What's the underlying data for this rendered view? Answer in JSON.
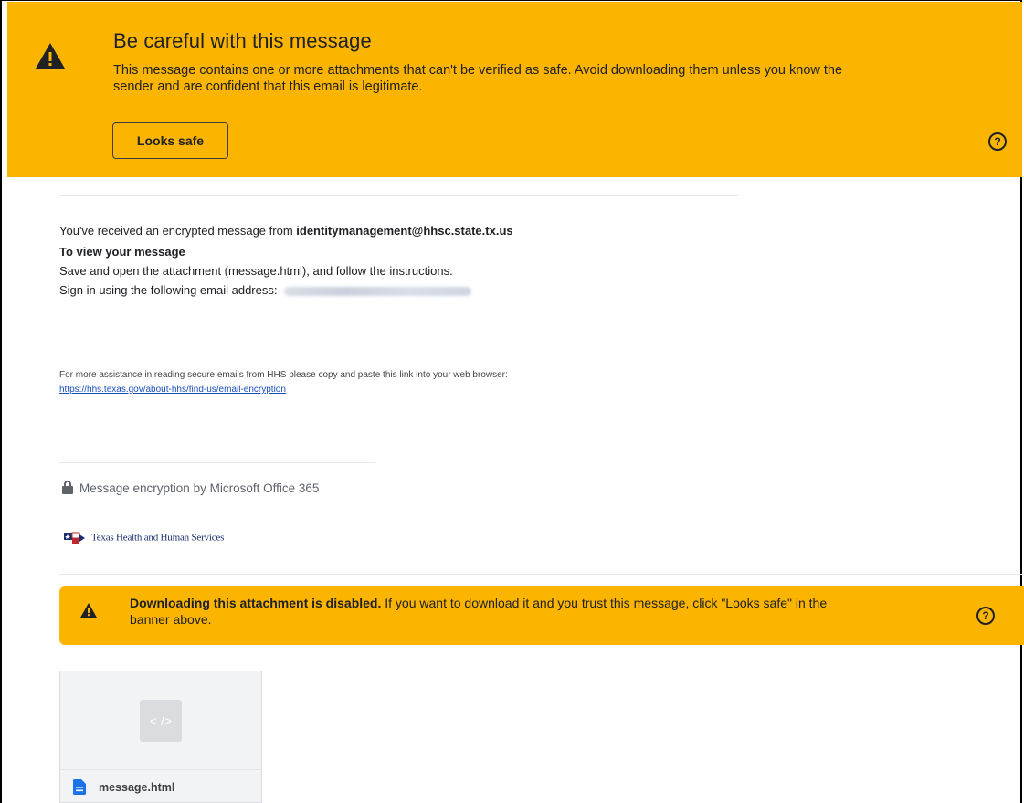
{
  "colors": {
    "banner": "#fbb400",
    "link": "#1a4fbd",
    "accent": "#1a73e8"
  },
  "top_banner": {
    "title": "Be careful with this message",
    "body": "This message contains one or more attachments that can't be verified as safe. Avoid downloading them unless you know the sender and are confident that this email is legitimate.",
    "button_label": "Looks safe",
    "warning_icon": "warning-triangle-icon",
    "help_icon": "help-circle-icon"
  },
  "message": {
    "intro": "You've received an encrypted message from ",
    "sender": "identitymanagement@hhsc.state.tx.us",
    "heading": "To view your message",
    "instruction": "Save and open the attachment (message.html), and follow the instructions.",
    "signin": "Sign in using the following email address: ",
    "assist_text": "For more assistance in reading secure emails from HHS please copy and paste this link into your web browser:",
    "assist_link": "https://hhs.texas.gov/about-hhs/find-us/email-encryption",
    "encryption_note": "Message encryption by Microsoft Office 365",
    "org_name": "Texas Health and Human Services"
  },
  "attachment_banner": {
    "bold": "Downloading this attachment is disabled.",
    "rest": " If you want to download it and you trust this message, click \"Looks safe\" in the banner above."
  },
  "attachment": {
    "preview_glyph": "< />",
    "filename": "message.html",
    "file_icon": "document-icon"
  }
}
